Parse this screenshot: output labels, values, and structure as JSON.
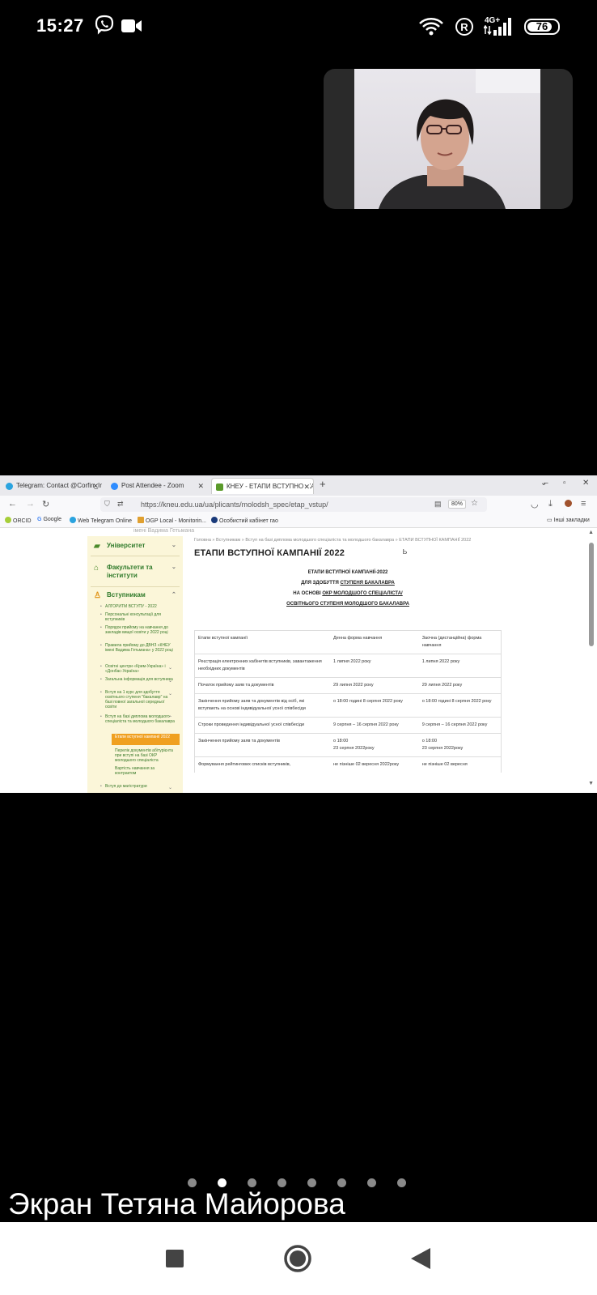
{
  "status_bar": {
    "time": "15:27",
    "network": "4G+",
    "battery": "76",
    "icons": [
      "viber-icon",
      "video-camera-icon",
      "wifi-icon",
      "registered-icon",
      "signal-icon",
      "battery-icon"
    ]
  },
  "browser": {
    "tabs": [
      {
        "label": "Telegram: Contact @Corfin_Inf",
        "icon": "telegram-icon",
        "active": false
      },
      {
        "label": "Post Attendee - Zoom",
        "icon": "zoom-icon",
        "active": false
      },
      {
        "label": "КНЕУ - ЕТАПИ ВСТУПНОЇ КАМ",
        "icon": "kneu-icon",
        "active": true
      }
    ],
    "url": "https://kneu.edu.ua/ua/plicants/molodsh_spec/etap_vstup/",
    "zoom": "80%",
    "bookmarks": [
      "ORCID",
      "Google",
      "Web Telegram Online",
      "OGP Local - Monitorin...",
      "Особистий кабінет гао"
    ],
    "other_bookmarks": "Інші закладки"
  },
  "site": {
    "header_strip": "імені Вадима Гетьмана",
    "sidebar": {
      "sections": [
        "Університет",
        "Факультети та інститути",
        "Вступникам"
      ],
      "items": [
        "АЛГОРИТМ ВСТУПУ - 2022",
        "Персональні консультації для вступників",
        "Порядок прийому на навчання до закладів вищої освіти у 2022 році",
        "Правила прийому до ДВНЗ «КНЕУ імені Вадима Гетьмана» у 2022 році",
        "Освітні центри «Крим-Україна» і «Донбас-Україна»",
        "Загальна інформація для вступника",
        "Вступ на 1 курс для здобуття освітнього ступеня \"бакалавр\" на базі повної загальної середньої освіти",
        "Вступ на базі диплома молодшого спеціаліста та молодшого бакалавра"
      ],
      "active_item": "Етапи вступної кампанії 2022",
      "sub_items": [
        "Перелік документів абітурієнта при вступі на базі ОКР молодшого спеціаліста",
        "Вартість навчання за контрактом"
      ],
      "last_item": "Вступ до магістратури"
    },
    "breadcrumb": "Головна » Вступникам » Вступ на базі диплома молодшого спеціаліста та молодшого бакалавра » ЕТАПИ ВСТУПНОЇ КАМПАНІЇ 2022",
    "title": "ЕТАПИ ВСТУПНОЇ КАМПАНІЇ 2022",
    "intro": {
      "line1": "ЕТАПИ ВСТУПНОЇ КАМПАНІЇ-2022",
      "line2_prefix": "ДЛЯ ЗДОБУТТЯ",
      "line2_link": "СТУПЕНЯ БАКАЛАВРА",
      "line3_prefix": "НА ОСНОВІ",
      "line3_link": "ОКР МОЛОДШОГО СПЕЦІАЛІСТА/",
      "line4": "ОСВІТНЬОГО СТУПЕНЯ МОЛОДШОГО БАКАЛАВРА"
    },
    "table": {
      "headers": [
        "Етапи вступної кампанії",
        "Денна форма навчання",
        "Заочна (дистанційна) форма навчання"
      ],
      "rows": [
        [
          "Реєстрація електронних кабінетів вступників, завантаження необхідних документів",
          "1 липня 2022 року",
          "1 липня 2022 року"
        ],
        [
          "Початок прийому заяв та документів",
          "29 липня 2022 року",
          "29 липня 2022 року"
        ],
        [
          "Закінчення прийому заяв та документів від осіб, які вступають на основі індивідуальної усної співбесіди",
          "о 18:00 годині 8 серпня 2022 року",
          "о 18:00 годині 8 серпня 2022 року"
        ],
        [
          "Строки проведення індивідуальної усної співбесіди",
          "9 серпня – 16 серпня 2022 року",
          "9 серпня – 16 серпня 2022 року"
        ],
        [
          "Закінчення прийому заяв та документів",
          "о 18:00\n23 серпня 2022року",
          "о 18:00\n23 серпня 2022року"
        ],
        [
          "Формування рейтингових списків вступників,",
          "не пізніше 02 вересня 2022року",
          "не пізніше 02 вересня"
        ]
      ]
    }
  },
  "zoom": {
    "caption": "Экран Тетяна Майорова",
    "page_count": 8,
    "active_page": 2
  }
}
